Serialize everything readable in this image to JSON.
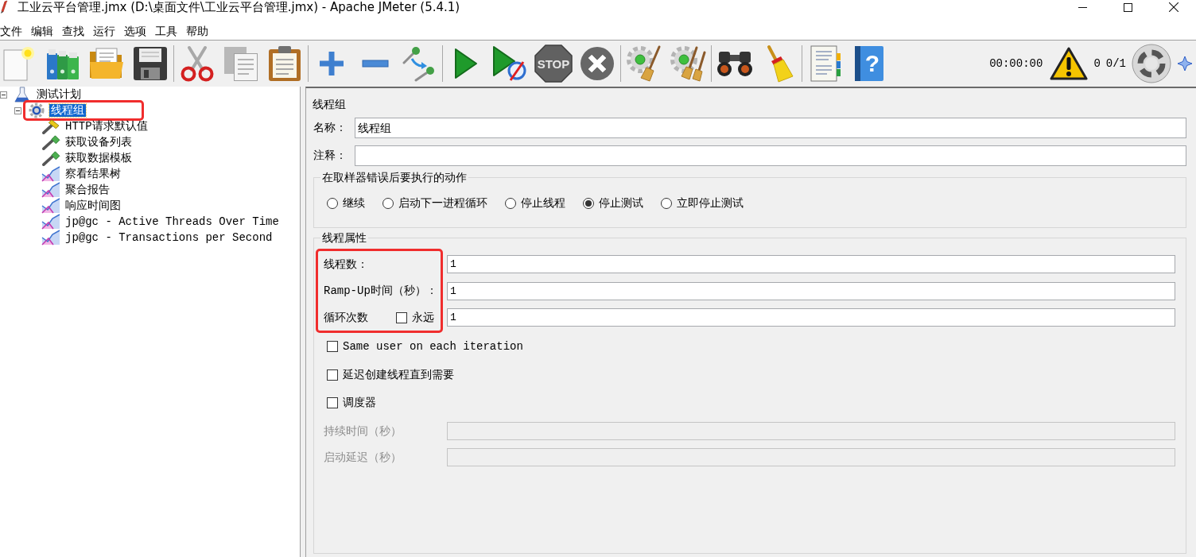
{
  "window": {
    "title": "工业云平台管理.jmx (D:\\桌面文件\\工业云平台管理.jmx) - Apache JMeter (5.4.1)"
  },
  "menu": [
    "文件",
    "编辑",
    "查找",
    "运行",
    "选项",
    "工具",
    "帮助"
  ],
  "toolbar": {
    "groups": [
      [
        {
          "kind": "new",
          "disabled": false
        },
        {
          "kind": "templates",
          "disabled": false
        },
        {
          "kind": "open",
          "disabled": false
        },
        {
          "kind": "save",
          "disabled": false
        }
      ],
      [
        {
          "kind": "cut",
          "disabled": false
        },
        {
          "kind": "copy",
          "disabled": false
        },
        {
          "kind": "paste",
          "disabled": false
        }
      ],
      [
        {
          "kind": "expand",
          "disabled": false
        },
        {
          "kind": "collapse",
          "disabled": false
        },
        {
          "kind": "toggle",
          "disabled": false
        }
      ],
      [
        {
          "kind": "start",
          "disabled": false
        },
        {
          "kind": "start_no_pauses",
          "disabled": false
        },
        {
          "kind": "stop",
          "disabled": true,
          "text": "STOP"
        },
        {
          "kind": "shutdown",
          "disabled": true
        }
      ],
      [
        {
          "kind": "clear",
          "disabled": false
        },
        {
          "kind": "clear_all",
          "disabled": false
        }
      ],
      [
        {
          "kind": "search",
          "disabled": false
        },
        {
          "kind": "reset_search",
          "disabled": false
        }
      ],
      [
        {
          "kind": "function_helper",
          "disabled": false
        },
        {
          "kind": "help",
          "disabled": false,
          "text": "?"
        }
      ]
    ],
    "timer": "00:00:00",
    "error_count": "0",
    "threads": "0/1"
  },
  "tree": {
    "nodes": [
      {
        "label": "测试计划",
        "kind": "plan",
        "selected": false,
        "highlighted": false,
        "expanded": true,
        "children": [
          {
            "label": "线程组",
            "kind": "thread_group",
            "selected": true,
            "highlighted": true,
            "expanded": true,
            "children": [
              {
                "label": "HTTP请求默认值",
                "kind": "config",
                "selected": false,
                "highlighted": false
              },
              {
                "label": "获取设备列表",
                "kind": "sampler",
                "selected": false,
                "highlighted": false
              },
              {
                "label": "获取数据模板",
                "kind": "sampler",
                "selected": false,
                "highlighted": false
              },
              {
                "label": "察看结果树",
                "kind": "listener",
                "selected": false,
                "highlighted": false
              },
              {
                "label": "聚合报告",
                "kind": "listener",
                "selected": false,
                "highlighted": false
              },
              {
                "label": "响应时间图",
                "kind": "listener",
                "selected": false,
                "highlighted": false
              },
              {
                "label": "jp@gc - Active Threads Over Time",
                "kind": "listener",
                "selected": false,
                "highlighted": false
              },
              {
                "label": "jp@gc - Transactions per Second",
                "kind": "listener",
                "selected": false,
                "highlighted": false
              }
            ]
          }
        ]
      }
    ]
  },
  "editor": {
    "title": "线程组",
    "name": {
      "label": "名称：",
      "value": "线程组"
    },
    "comment": {
      "label": "注释："
    },
    "on_error": {
      "title": "在取样器错误后要执行的动作",
      "options": [
        {
          "label": "继续",
          "selected": false
        },
        {
          "label": "启动下一进程循环",
          "selected": false
        },
        {
          "label": "停止线程",
          "selected": false
        },
        {
          "label": "停止测试",
          "selected": true
        },
        {
          "label": "立即停止测试",
          "selected": false
        }
      ]
    },
    "thread_properties": {
      "title": "线程属性",
      "highlighted": true,
      "fields": [
        {
          "label": "线程数：",
          "value": "1"
        },
        {
          "label": "Ramp-Up时间（秒）：",
          "value": "1"
        },
        {
          "label": "循环次数",
          "value": "1",
          "forever": {
            "label": "永远",
            "checked": false
          }
        }
      ],
      "options": [
        {
          "label": "Same user on each iteration",
          "checked": false
        },
        {
          "label": "延迟创建线程直到需要",
          "checked": false
        },
        {
          "label": "调度器",
          "checked": false
        }
      ],
      "schedule": [
        {
          "label": "持续时间（秒）",
          "disabled": true
        },
        {
          "label": "启动延迟（秒）",
          "disabled": true
        }
      ]
    }
  }
}
